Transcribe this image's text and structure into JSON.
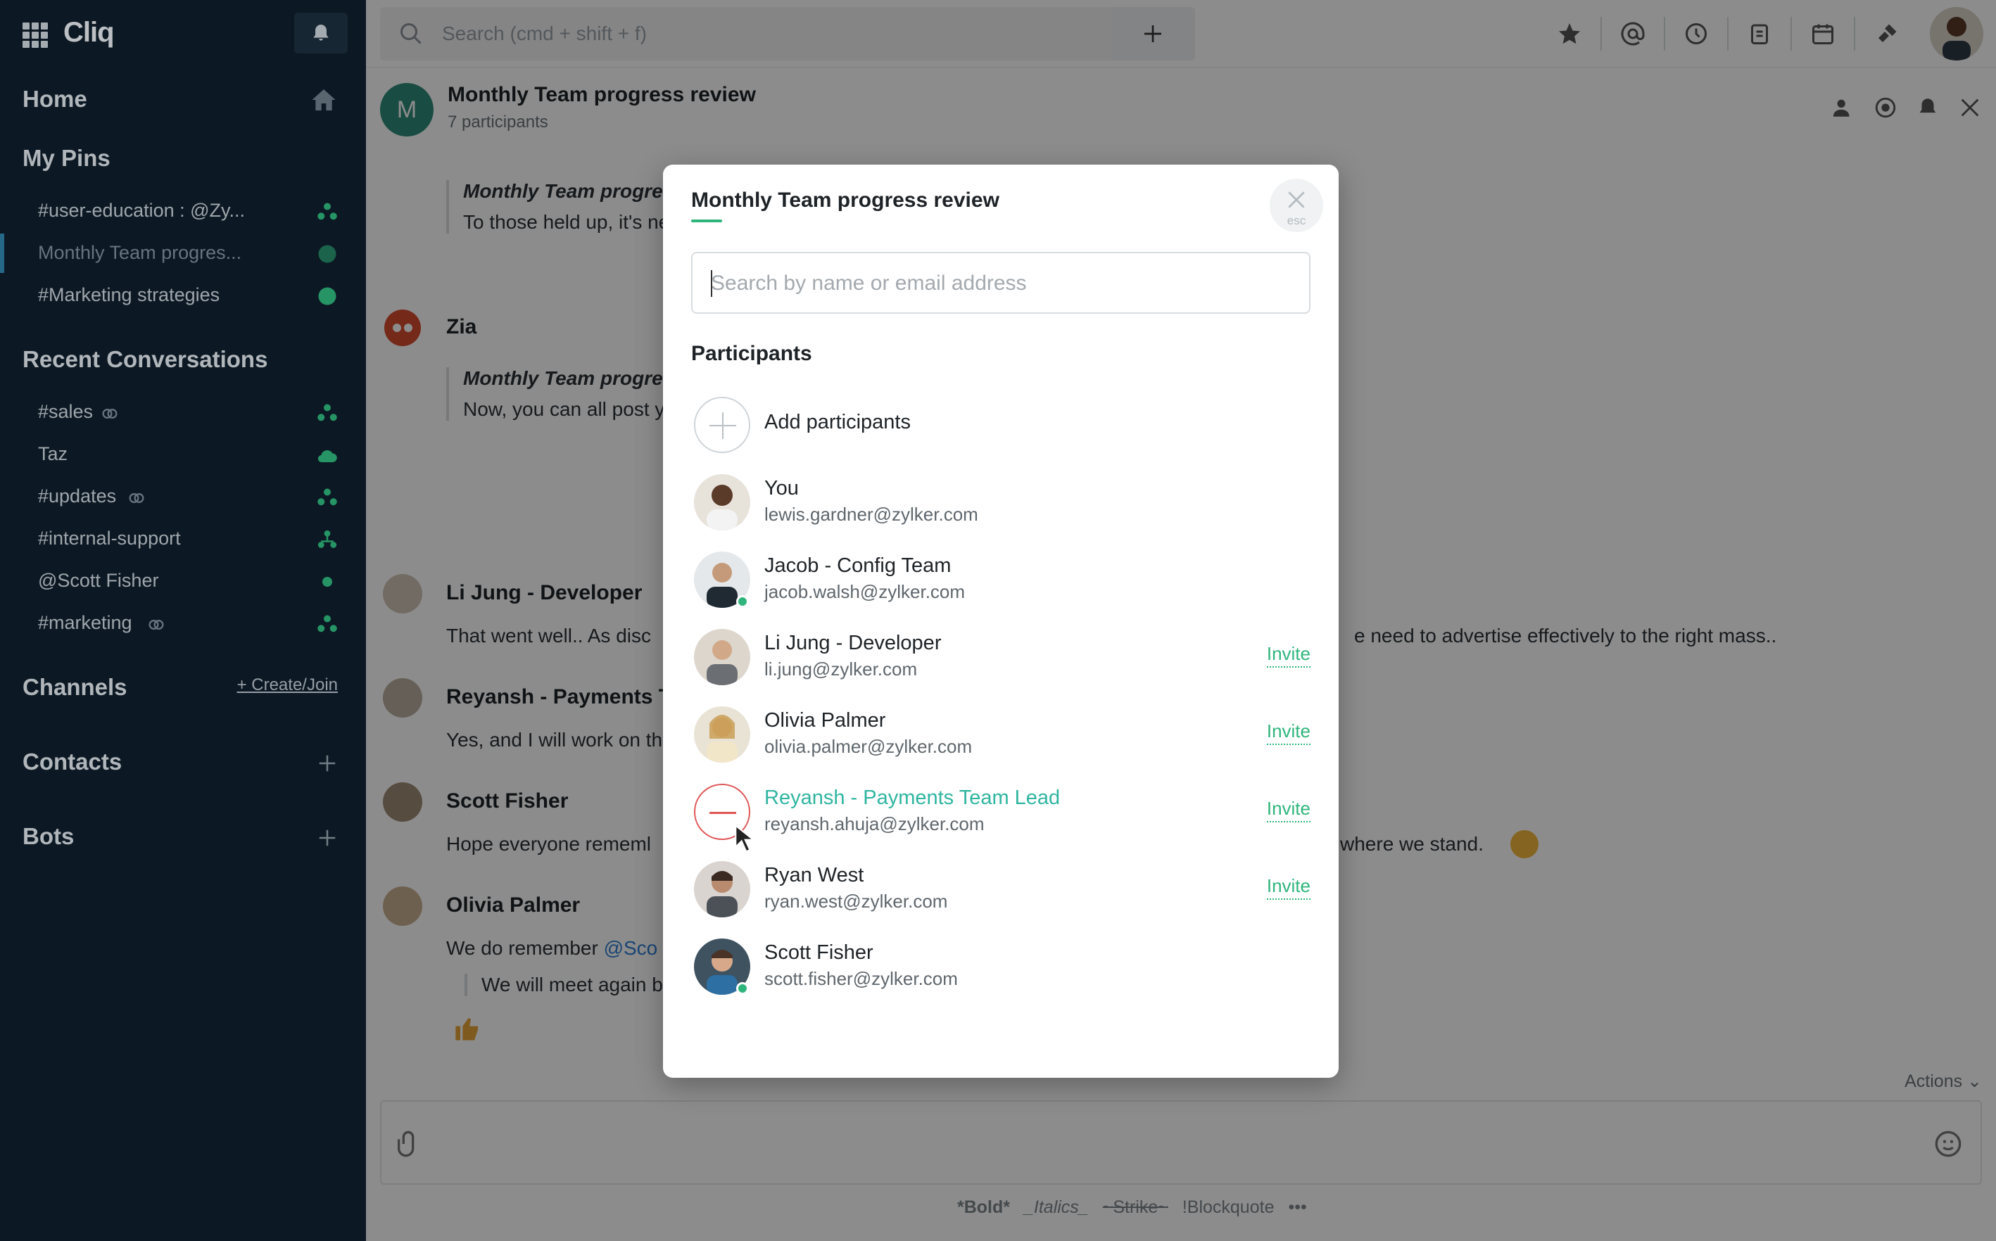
{
  "sidebar": {
    "logo": "Cliq",
    "home": "Home",
    "my_pins": "My Pins",
    "pins": [
      {
        "label": "#user-education : @Zy..."
      },
      {
        "label": "Monthly Team progres..."
      },
      {
        "label": "#Marketing strategies"
      }
    ],
    "recent_title": "Recent Conversations",
    "recent": [
      {
        "label": "#sales"
      },
      {
        "label": "Taz"
      },
      {
        "label": "#updates"
      },
      {
        "label": "#internal-support"
      },
      {
        "label": "@Scott Fisher"
      },
      {
        "label": "#marketing"
      }
    ],
    "channels": "Channels",
    "create_join": "+ Create/Join",
    "contacts": "Contacts",
    "bots": "Bots"
  },
  "topbar": {
    "search_placeholder": "Search (cmd + shift + f)"
  },
  "chat": {
    "avatar_letter": "M",
    "title": "Monthly Team progress review",
    "participants_count": "7 participants",
    "messages": [
      {
        "quote_title": "Monthly Team progres",
        "quote_body": "To those held up, it's ne"
      },
      {
        "sender": "Zia",
        "quote_title": "Monthly Team progres",
        "quote_body": "Now, you can all post yo"
      },
      {
        "sender": "Li Jung - Developer",
        "text_start": "That went well.. As disc",
        "text_end": "e need to advertise effectively to the right mass.."
      },
      {
        "sender": "Reyansh - Payments Te",
        "text_start": "Yes, and I will work on th"
      },
      {
        "sender": "Scott Fisher",
        "text_start": "Hope everyone rememl",
        "text_end": "where we stand."
      },
      {
        "sender": "Olivia Palmer",
        "text_start": "We do remember ",
        "mention": "@Sco",
        "quote": "We will meet again by"
      }
    ],
    "actions_label": "Actions",
    "format": [
      "*Bold*",
      "_Italics_",
      "~Strike~",
      "!Blockquote",
      "•••"
    ]
  },
  "modal": {
    "title": "Monthly Team progress review",
    "esc": "esc",
    "search_placeholder": "Search by name or email address",
    "section": "Participants",
    "add_label": "Add participants",
    "invite_label": "Invite",
    "participants": [
      {
        "name": "You",
        "email": "lewis.gardner@zylker.com"
      },
      {
        "name": "Jacob - Config Team",
        "email": "jacob.walsh@zylker.com"
      },
      {
        "name": "Li Jung - Developer",
        "email": "li.jung@zylker.com"
      },
      {
        "name": "Olivia Palmer",
        "email": "olivia.palmer@zylker.com"
      },
      {
        "name": "Reyansh - Payments Team Lead",
        "email": "reyansh.ahuja@zylker.com"
      },
      {
        "name": "Ryan West",
        "email": "ryan.west@zylker.com"
      },
      {
        "name": "Scott Fisher",
        "email": "scott.fisher@zylker.com"
      }
    ]
  },
  "colors": {
    "sidebar_bg": "#0f1f2c",
    "accent_green": "#2fb57c",
    "remove_red": "#e05656"
  }
}
